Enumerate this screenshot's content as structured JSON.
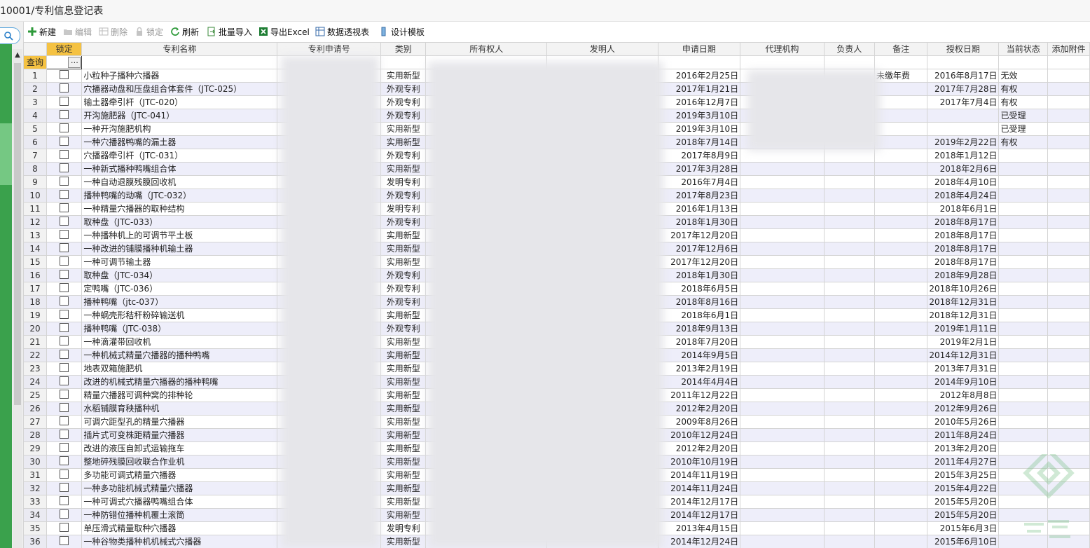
{
  "title": "10001/专利信息登记表",
  "toolbar": [
    {
      "label": "新建",
      "icon": "plus-icon",
      "enabled": true
    },
    {
      "label": "编辑",
      "icon": "folder-icon",
      "enabled": false
    },
    {
      "label": "删除",
      "icon": "delete-grid-icon",
      "enabled": false
    },
    {
      "label": "锁定",
      "icon": "lock-icon",
      "enabled": false
    },
    {
      "label": "刷新",
      "icon": "refresh-icon",
      "enabled": true
    },
    {
      "label": "批量导入",
      "icon": "import-icon",
      "enabled": true
    },
    {
      "label": "导出Excel",
      "icon": "excel-icon",
      "enabled": true
    },
    {
      "label": "数据透视表",
      "icon": "pivot-icon",
      "enabled": true
    },
    {
      "label": "设计模板",
      "icon": "template-icon",
      "enabled": true
    }
  ],
  "columns": [
    "锁定",
    "专利名称",
    "专利申请号",
    "类别",
    "所有权人",
    "发明人",
    "申请日期",
    "代理机构",
    "负责人",
    "备注",
    "授权日期",
    "当前状态",
    "添加附件"
  ],
  "filter_label": "查询",
  "rows": [
    {
      "n": "1",
      "name": "小粒种子播种穴播器",
      "type": "实用新型",
      "apply": "2016年2月25日",
      "note": "未缴年费",
      "grant": "2016年8月17日",
      "status": "无效"
    },
    {
      "n": "2",
      "name": "穴播器动盘和压盘组合体套件（JTC-025）",
      "type": "外观专利",
      "apply": "2017年1月21日",
      "note": "",
      "grant": "2017年7月28日",
      "status": "有权"
    },
    {
      "n": "3",
      "name": "输土器牵引杆（JTC-020）",
      "type": "外观专利",
      "apply": "2016年12月7日",
      "note": "",
      "grant": "2017年7月4日",
      "status": "有权"
    },
    {
      "n": "4",
      "name": "开沟施肥器（JTC-041）",
      "type": "外观专利",
      "apply": "2019年3月10日",
      "note": "",
      "grant": "",
      "status": "已受理"
    },
    {
      "n": "5",
      "name": "一种开沟施肥机构",
      "type": "实用新型",
      "apply": "2019年3月10日",
      "note": "",
      "grant": "",
      "status": "已受理"
    },
    {
      "n": "6",
      "name": "一种穴播器鸭嘴的漏土器",
      "type": "实用新型",
      "apply": "2018年7月14日",
      "note": "",
      "grant": "2019年2月22日",
      "status": "有权"
    },
    {
      "n": "7",
      "name": "穴播器牵引杆（JTC-031）",
      "type": "外观专利",
      "apply": "2017年8月9日",
      "note": "",
      "grant": "2018年1月12日",
      "status": ""
    },
    {
      "n": "8",
      "name": "一种新式播种鸭嘴组合体",
      "type": "实用新型",
      "apply": "2017年3月28日",
      "note": "",
      "grant": "2018年2月6日",
      "status": ""
    },
    {
      "n": "9",
      "name": "一种自动退膜残膜回收机",
      "type": "发明专利",
      "apply": "2016年7月4日",
      "note": "",
      "grant": "2018年4月10日",
      "status": ""
    },
    {
      "n": "10",
      "name": "播种鸭嘴的动嘴（JTC-032）",
      "type": "外观专利",
      "apply": "2017年8月23日",
      "note": "",
      "grant": "2018年4月24日",
      "status": ""
    },
    {
      "n": "11",
      "name": "一种精量穴播器的取种结构",
      "type": "发明专利",
      "apply": "2016年1月13日",
      "note": "",
      "grant": "2018年6月1日",
      "status": ""
    },
    {
      "n": "12",
      "name": "取种盘（JTC-033）",
      "type": "外观专利",
      "apply": "2018年1月30日",
      "note": "",
      "grant": "2018年8月17日",
      "status": ""
    },
    {
      "n": "13",
      "name": "一种播种机上的可调节平土板",
      "type": "实用新型",
      "apply": "2017年12月20日",
      "note": "",
      "grant": "2018年8月17日",
      "status": ""
    },
    {
      "n": "14",
      "name": "一种改进的铺膜播种机输土器",
      "type": "实用新型",
      "apply": "2017年12月6日",
      "note": "",
      "grant": "2018年8月17日",
      "status": ""
    },
    {
      "n": "15",
      "name": "一种可调节输土器",
      "type": "实用新型",
      "apply": "2017年12月20日",
      "note": "",
      "grant": "2018年8月17日",
      "status": ""
    },
    {
      "n": "16",
      "name": "取种盘（JTC-034）",
      "type": "外观专利",
      "apply": "2018年1月30日",
      "note": "",
      "grant": "2018年9月28日",
      "status": ""
    },
    {
      "n": "17",
      "name": "定鸭嘴（JTC-036）",
      "type": "外观专利",
      "apply": "2018年6月5日",
      "note": "",
      "grant": "2018年10月26日",
      "status": ""
    },
    {
      "n": "18",
      "name": "播种鸭嘴（jtc-037）",
      "type": "外观专利",
      "apply": "2018年8月16日",
      "note": "",
      "grant": "2018年12月31日",
      "status": ""
    },
    {
      "n": "19",
      "name": "一种蜗壳形秸秆粉碎输送机",
      "type": "实用新型",
      "apply": "2018年6月1日",
      "note": "",
      "grant": "2018年12月31日",
      "status": ""
    },
    {
      "n": "20",
      "name": "播种鸭嘴（JTC-038）",
      "type": "外观专利",
      "apply": "2018年9月13日",
      "note": "",
      "grant": "2019年1月11日",
      "status": ""
    },
    {
      "n": "21",
      "name": "一种滴灌带回收机",
      "type": "实用新型",
      "apply": "2018年7月20日",
      "note": "",
      "grant": "2019年2月1日",
      "status": ""
    },
    {
      "n": "22",
      "name": "一种机械式精量穴播器的播种鸭嘴",
      "type": "实用新型",
      "apply": "2014年9月5日",
      "note": "",
      "grant": "2014年12月31日",
      "status": ""
    },
    {
      "n": "23",
      "name": "地表双箱施肥机",
      "type": "实用新型",
      "apply": "2013年2月19日",
      "note": "",
      "grant": "2013年7月31日",
      "status": ""
    },
    {
      "n": "24",
      "name": "改进的机械式精量穴播器的播种鸭嘴",
      "type": "实用新型",
      "apply": "2014年4月4日",
      "note": "",
      "grant": "2014年9月10日",
      "status": ""
    },
    {
      "n": "25",
      "name": "精量穴播器可调种窝的排种轮",
      "type": "实用新型",
      "apply": "2011年12月22日",
      "note": "",
      "grant": "2012年8月8日",
      "status": ""
    },
    {
      "n": "26",
      "name": "水稻铺膜育秧播种机",
      "type": "实用新型",
      "apply": "2012年2月20日",
      "note": "",
      "grant": "2012年9月26日",
      "status": ""
    },
    {
      "n": "27",
      "name": "可调穴距型孔的精量穴播器",
      "type": "实用新型",
      "apply": "2009年8月26日",
      "note": "",
      "grant": "2010年5月26日",
      "status": ""
    },
    {
      "n": "28",
      "name": "插片式可变株距精量穴播器",
      "type": "实用新型",
      "apply": "2010年12月24日",
      "note": "",
      "grant": "2011年8月24日",
      "status": ""
    },
    {
      "n": "29",
      "name": "改进的液压自卸式运输拖车",
      "type": "实用新型",
      "apply": "2012年2月20日",
      "note": "",
      "grant": "2013年2月20日",
      "status": ""
    },
    {
      "n": "30",
      "name": "整地碎残膜回收联合作业机",
      "type": "实用新型",
      "apply": "2010年10月19日",
      "note": "",
      "grant": "2011年4月27日",
      "status": ""
    },
    {
      "n": "31",
      "name": "多功能可调式精量穴播器",
      "type": "实用新型",
      "apply": "2014年11月19日",
      "note": "",
      "grant": "2015年3月25日",
      "status": ""
    },
    {
      "n": "32",
      "name": "一种多功能机械式精量穴播器",
      "type": "实用新型",
      "apply": "2014年11月24日",
      "note": "",
      "grant": "2015年4月22日",
      "status": ""
    },
    {
      "n": "33",
      "name": "一种可调式穴播器鸭嘴组合体",
      "type": "实用新型",
      "apply": "2014年12月17日",
      "note": "",
      "grant": "2015年5月20日",
      "status": ""
    },
    {
      "n": "34",
      "name": "一种防错位播种机覆土滚筒",
      "type": "实用新型",
      "apply": "2014年12月17日",
      "note": "",
      "grant": "2015年5月20日",
      "status": ""
    },
    {
      "n": "35",
      "name": "单压滑式精量取种穴播器",
      "type": "发明专利",
      "apply": "2013年4月15日",
      "note": "",
      "grant": "2015年6月3日",
      "status": ""
    },
    {
      "n": "36",
      "name": "一种谷物类播种机机械式穴播器",
      "type": "实用新型",
      "apply": "2014年12月24日",
      "note": "",
      "grant": "2015年6月10日",
      "status": ""
    }
  ]
}
